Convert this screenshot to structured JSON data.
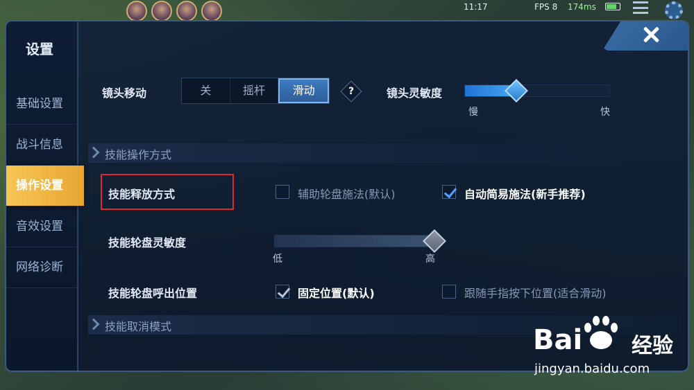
{
  "hud": {
    "time": "11:17",
    "fps": "FPS 8",
    "ping": "174ms"
  },
  "panel": {
    "title": "设置"
  },
  "sidebar": {
    "items": [
      {
        "label": "基础设置",
        "active": false
      },
      {
        "label": "战斗信息",
        "active": false
      },
      {
        "label": "操作设置",
        "active": true
      },
      {
        "label": "音效设置",
        "active": false
      },
      {
        "label": "网络诊断",
        "active": false
      }
    ]
  },
  "camera": {
    "label": "镜头移动",
    "options": [
      "关",
      "摇杆",
      "滑动"
    ],
    "selected": "滑动",
    "help": "?"
  },
  "camera_sensitivity": {
    "label": "镜头灵敏度",
    "min_label": "慢",
    "max_label": "快",
    "value": 0.35
  },
  "section_skill_op": {
    "title": "技能操作方式"
  },
  "skill_release": {
    "label": "技能释放方式",
    "option_a": "辅助轮盘施法(默认)",
    "option_a_checked": false,
    "option_b": "自动简易施法(新手推荐)",
    "option_b_checked": true
  },
  "wheel_sensitivity": {
    "label": "技能轮盘灵敏度",
    "min_label": "低",
    "max_label": "高",
    "value": 1.0
  },
  "wheel_position": {
    "label": "技能轮盘呼出位置",
    "option_a": "固定位置(默认)",
    "option_a_checked": true,
    "option_b": "跟随手指按下位置(适合滑动)",
    "option_b_checked": false
  },
  "section_skill_cancel": {
    "title": "技能取消模式"
  },
  "watermark": {
    "brand": "Bai",
    "brand2": "经验",
    "url": "jingyan.baidu.com"
  },
  "colors": {
    "accent": "#f6c553",
    "highlight": "#e0272e",
    "slider": "#2f86e0"
  }
}
